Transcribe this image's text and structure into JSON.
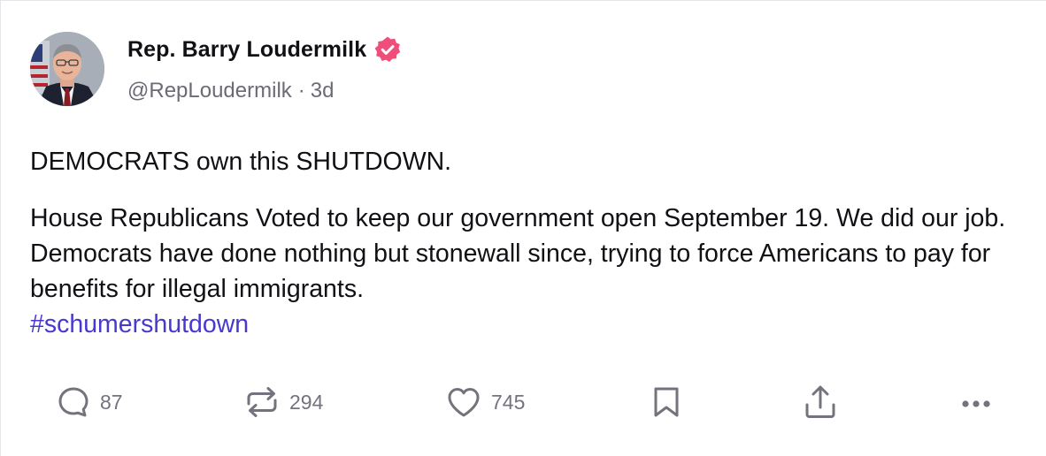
{
  "post": {
    "author": {
      "display_name": "Rep. Barry Loudermilk",
      "handle": "@RepLoudermilk",
      "verified": true,
      "verified_color": "#ef4e7b"
    },
    "separator": "·",
    "time_ago": "3d",
    "body": {
      "paragraph_1": "DEMOCRATS own this SHUTDOWN.",
      "paragraph_2": "House Republicans Voted to keep our government open September 19. We did our job. Democrats have done nothing but stonewall since, trying to force Americans to pay for benefits for illegal immigrants.",
      "hashtag": "#schumershutdown"
    },
    "hashtag_color": "#4838d1"
  },
  "actions": {
    "reply": {
      "icon": "reply-icon",
      "count": "87"
    },
    "repost": {
      "icon": "repost-icon",
      "count": "294"
    },
    "like": {
      "icon": "heart-icon",
      "count": "745"
    },
    "bookmark": {
      "icon": "bookmark-icon"
    },
    "share": {
      "icon": "share-icon"
    },
    "more": {
      "icon": "more-icon"
    }
  }
}
